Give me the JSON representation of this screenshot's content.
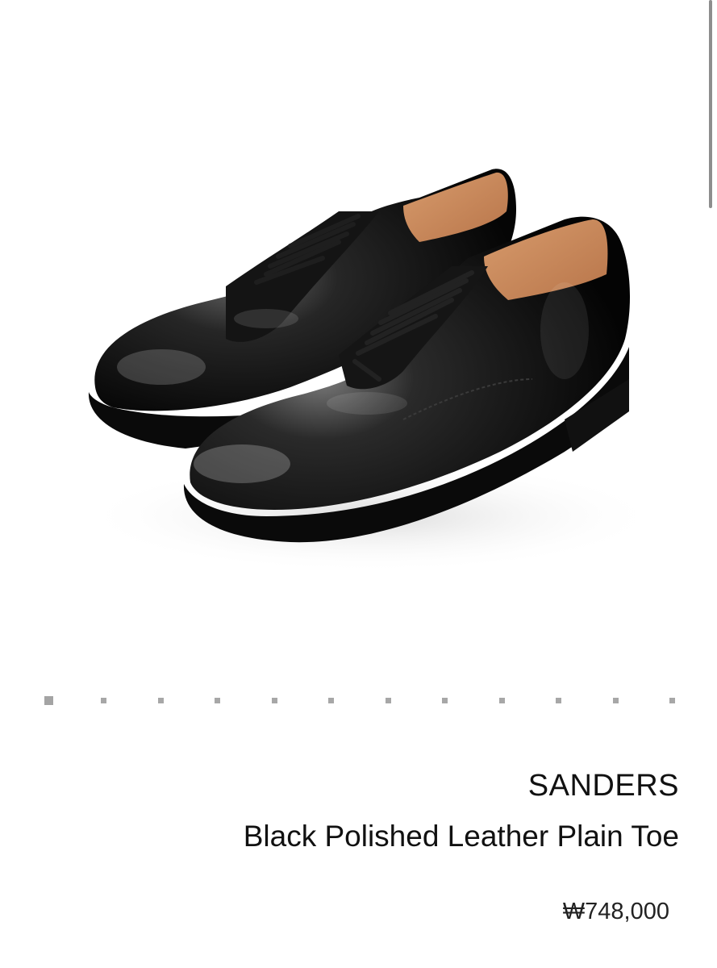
{
  "product": {
    "brand": "SANDERS",
    "name": "Black Polished Leather Plain Toe",
    "price": "₩748,000",
    "image": {
      "subject": "shoe-pair-icon"
    }
  },
  "gallery": {
    "page_count": 12,
    "active_index": 0
  },
  "colors": {
    "background": "#ffffff",
    "text": "#111111",
    "dot": "#a7a7a7",
    "leather": "#111111",
    "lining": "#c98a5c"
  }
}
